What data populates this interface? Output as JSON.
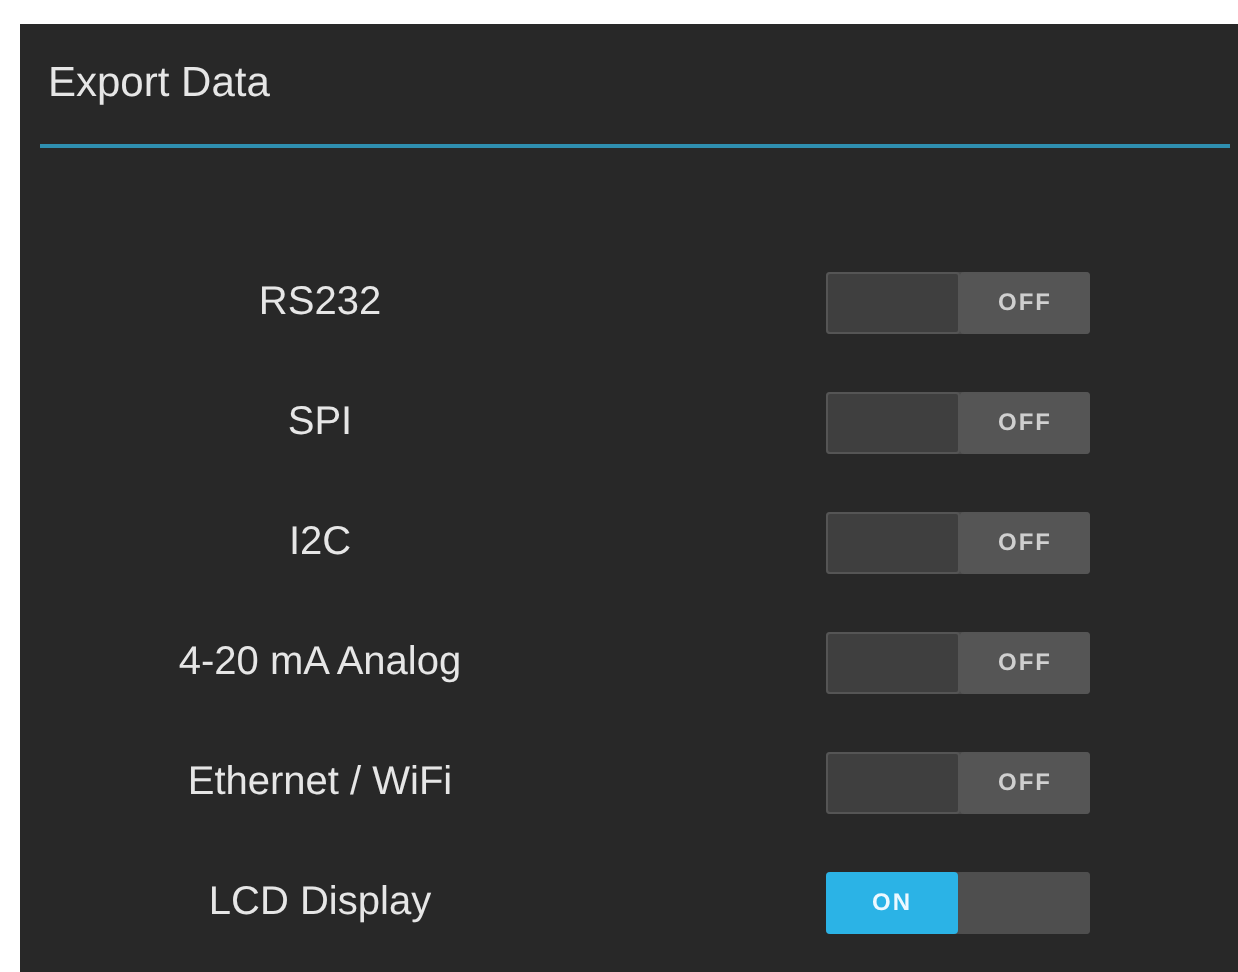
{
  "dialog": {
    "title": "Export Data"
  },
  "options": [
    {
      "label": "RS232",
      "on": false,
      "switch_text": "OFF"
    },
    {
      "label": "SPI",
      "on": false,
      "switch_text": "OFF"
    },
    {
      "label": "I2C",
      "on": false,
      "switch_text": "OFF"
    },
    {
      "label": "4-20 mA Analog",
      "on": false,
      "switch_text": "OFF"
    },
    {
      "label": "Ethernet / WiFi",
      "on": false,
      "switch_text": "OFF"
    },
    {
      "label": "LCD Display",
      "on": true,
      "switch_text": "ON"
    }
  ]
}
